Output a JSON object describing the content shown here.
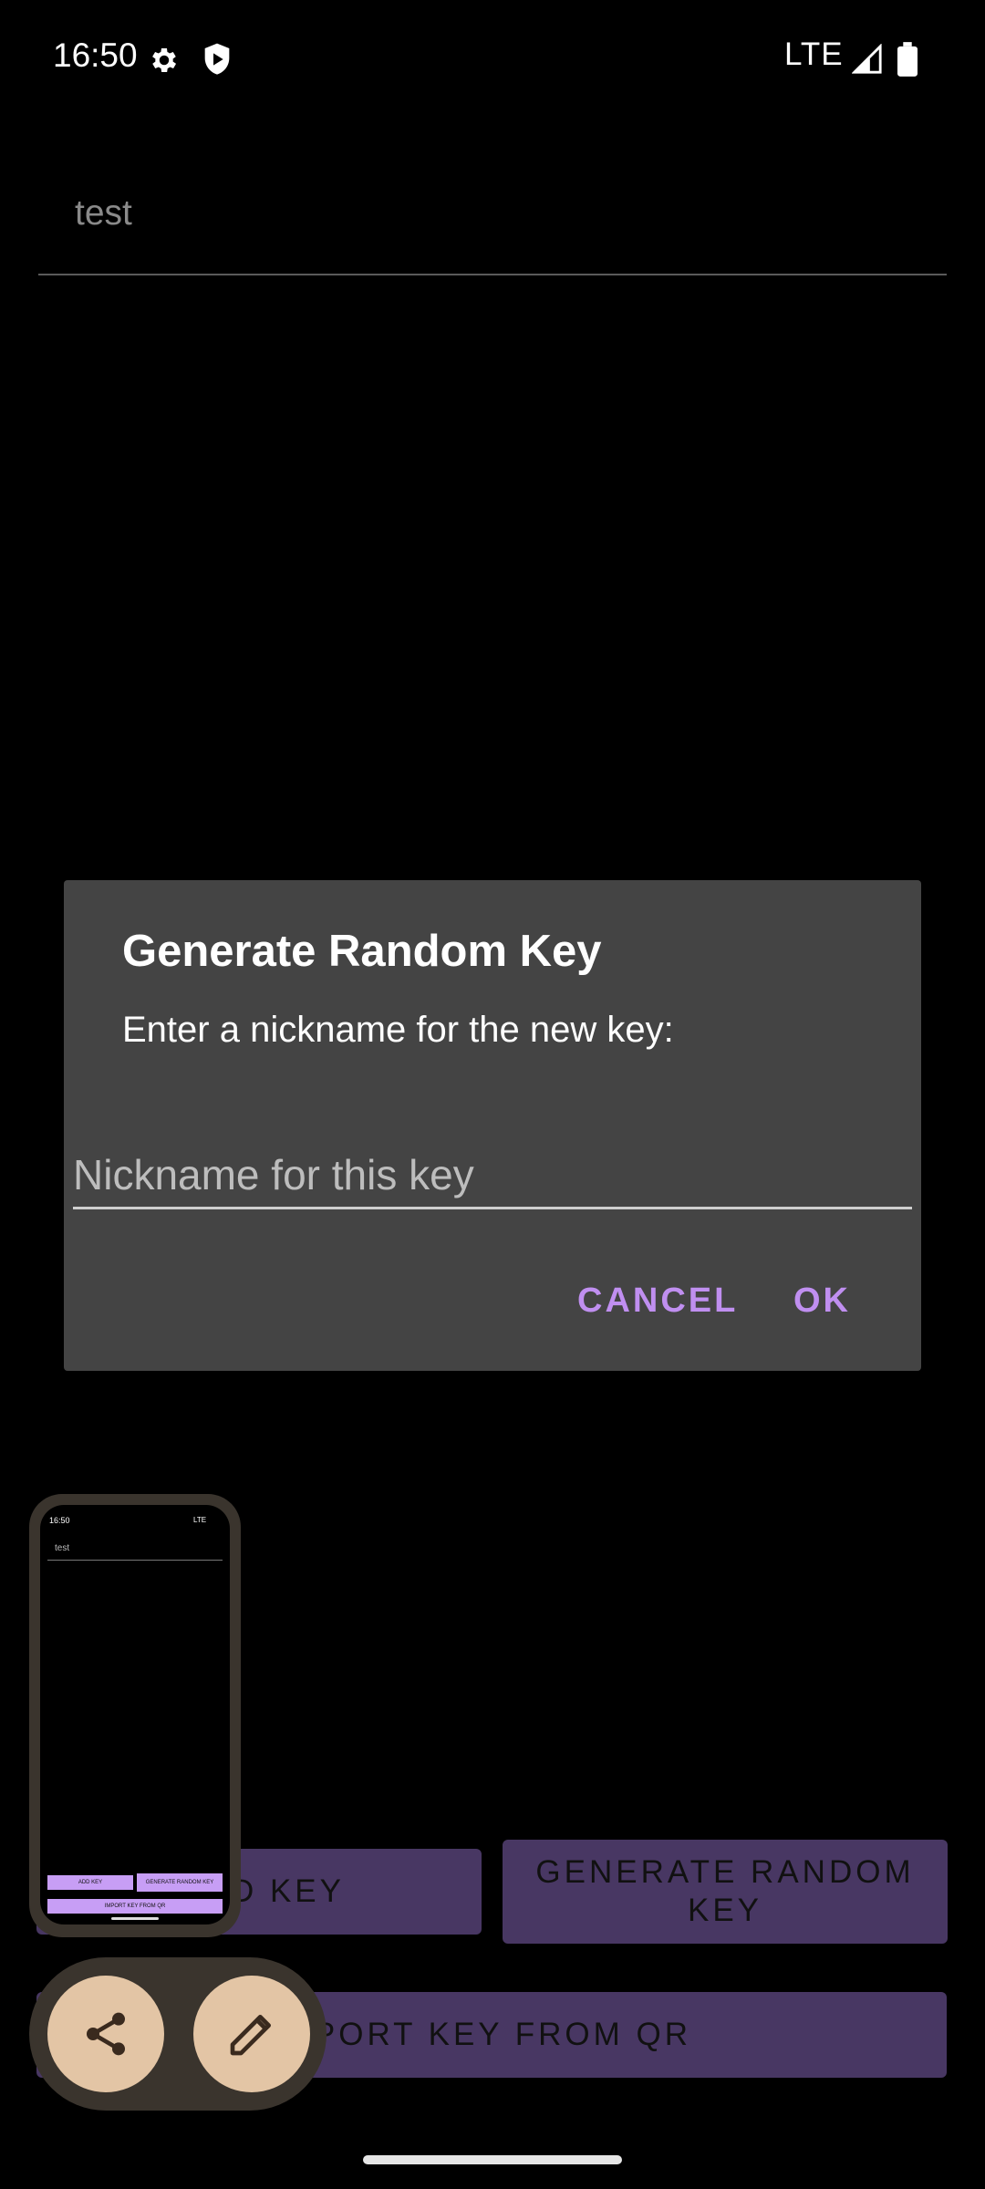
{
  "status_bar": {
    "time": "16:50",
    "network": "LTE",
    "icons": [
      "gear-icon",
      "shield-icon",
      "signal-icon",
      "battery-icon"
    ]
  },
  "background_field": {
    "value": "test"
  },
  "dialog": {
    "title": "Generate Random Key",
    "message": "Enter a nickname for the new key:",
    "input_placeholder": "Nickname for this key",
    "input_value": "",
    "cancel_label": "CANCEL",
    "ok_label": "OK",
    "accent_color": "#c08ff0"
  },
  "buttons": {
    "add_key": "D KEY",
    "generate_random_key": "GENERATE RANDOM KEY",
    "import_key_qr": "MPORT KEY FROM QR"
  },
  "thumbnail": {
    "time": "16:50",
    "status": "LTE",
    "field_value": "test",
    "add_key": "ADD KEY",
    "generate_key": "GENERATE RANDOM KEY",
    "import_key": "IMPORT KEY FROM QR"
  },
  "actions": {
    "share_icon": "share-icon",
    "edit_icon": "pencil-icon"
  }
}
